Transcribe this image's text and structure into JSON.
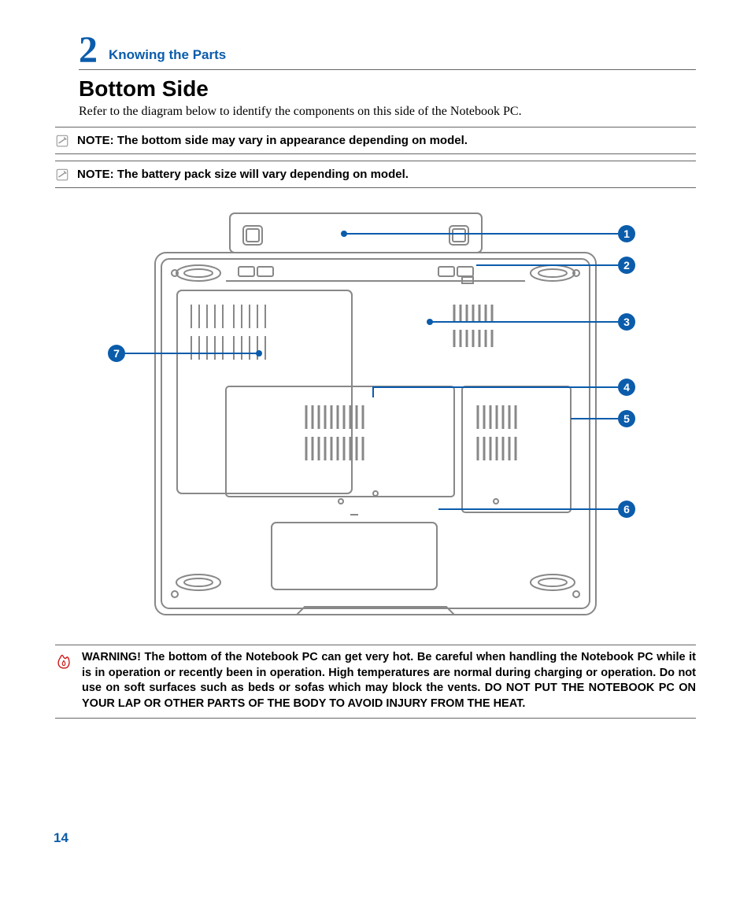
{
  "chapter": {
    "number": "2",
    "title": "Knowing the Parts"
  },
  "section": {
    "title": "Bottom Side",
    "intro": "Refer to the diagram below to identify the components on this side of the Notebook PC."
  },
  "notes": [
    "NOTE: The bottom side may vary in appearance depending on model.",
    "NOTE: The battery pack size will vary depending on model."
  ],
  "callouts": [
    "1",
    "2",
    "3",
    "4",
    "5",
    "6",
    "7"
  ],
  "warning": "WARNING!  The bottom of the Notebook PC can get very hot. Be careful when handling the Notebook PC while it is in operation or recently been in operation. High temperatures are normal during charging or operation. Do not use on soft surfaces such as beds or sofas which may block the vents. DO NOT PUT THE NOTEBOOK PC ON YOUR LAP OR OTHER PARTS OF THE BODY TO AVOID INJURY FROM THE HEAT.",
  "pageNumber": "14"
}
